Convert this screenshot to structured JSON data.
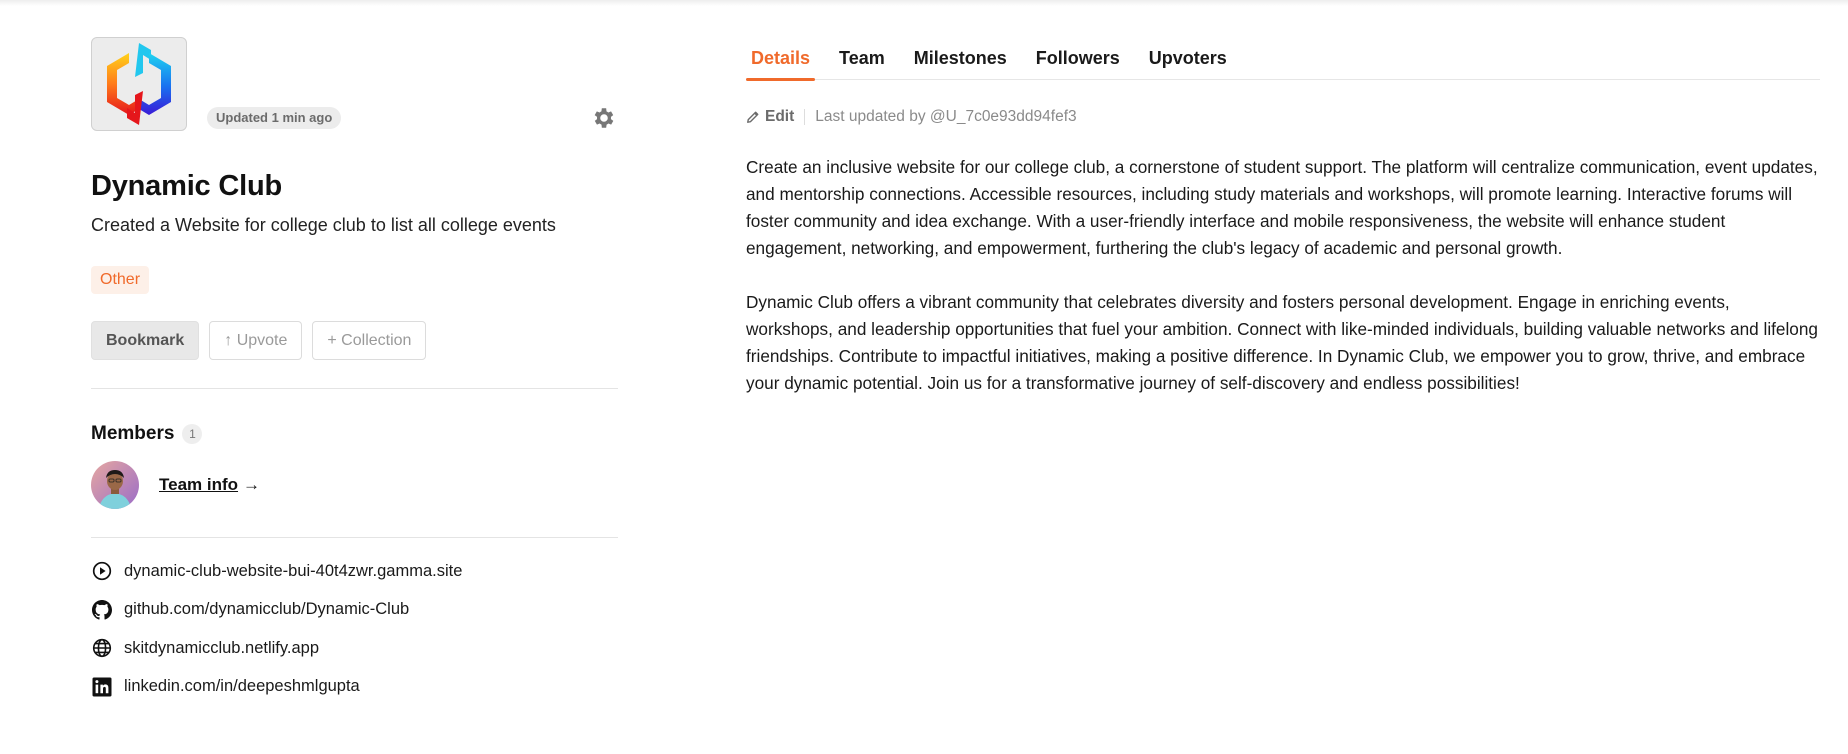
{
  "project": {
    "name": "Dynamic Club",
    "tagline": "Created a Website for college club to list all college events",
    "updated_badge": "Updated 1 min ago",
    "category_tag": "Other"
  },
  "actions": {
    "bookmark": "Bookmark",
    "upvote": "↑ Upvote",
    "collection": "+ Collection"
  },
  "members": {
    "heading": "Members",
    "count": "1",
    "team_info_link": "Team info",
    "arrow": "→"
  },
  "links": [
    {
      "icon": "play-circle-icon",
      "text": "dynamic-club-website-bui-40t4zwr.gamma.site"
    },
    {
      "icon": "github-icon",
      "text": "github.com/dynamicclub/Dynamic-Club"
    },
    {
      "icon": "globe-icon",
      "text": "skitdynamicclub.netlify.app"
    },
    {
      "icon": "linkedin-icon",
      "text": "linkedin.com/in/deepeshmlgupta"
    }
  ],
  "tabs": [
    {
      "label": "Details",
      "active": true
    },
    {
      "label": "Team",
      "active": false
    },
    {
      "label": "Milestones",
      "active": false
    },
    {
      "label": "Followers",
      "active": false
    },
    {
      "label": "Upvoters",
      "active": false
    }
  ],
  "details": {
    "edit_label": "Edit",
    "last_updated": "Last updated by @U_7c0e93dd94fef3",
    "paragraphs": [
      "Create an inclusive website for our college club, a cornerstone of student support. The platform will centralize communication, event updates, and mentorship connections. Accessible resources, including study materials and workshops, will promote learning. Interactive forums will foster community and idea exchange. With a user-friendly interface and mobile responsiveness, the website will enhance student engagement, networking, and empowerment, furthering the club's legacy of academic and personal growth.",
      "Dynamic Club offers a vibrant community that celebrates diversity and fosters personal development. Engage in enriching events, workshops, and leadership opportunities that fuel your ambition. Connect with like-minded individuals, building valuable networks and lifelong friendships. Contribute to impactful initiatives, making a positive difference. In Dynamic Club, we empower you to grow, thrive, and embrace your dynamic potential. Join us for a transformative journey of self-discovery and endless possibilities!"
    ]
  },
  "colors": {
    "accent": "#f06a2b",
    "tag_bg": "#fdf0e8",
    "muted_text": "#8a8a8a"
  }
}
